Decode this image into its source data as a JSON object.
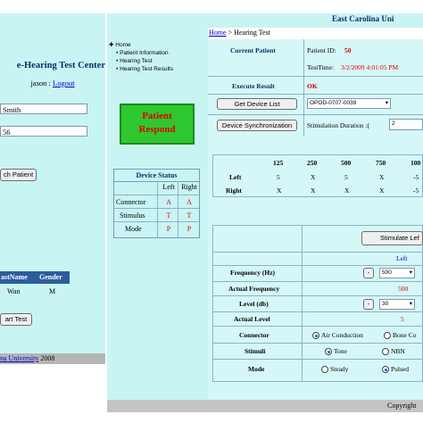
{
  "left": {
    "title": "e-Hearing Test Center",
    "user": "jason : ",
    "logout": "Logout",
    "first_name_value": "Smith",
    "id_value": "56",
    "search_button": "ch Patient",
    "table_headers": [
      "astName",
      "Gender"
    ],
    "table_row": [
      "Wan",
      "M"
    ],
    "start_button": "art Test",
    "footer_link": "na University",
    "footer_year": "2008"
  },
  "header": {
    "title": "East Carolina Uni"
  },
  "breadcrumb": {
    "home": "Home",
    "separator": " > ",
    "current": "Hearing Test"
  },
  "nav": {
    "items": [
      "Home",
      "Patient Information",
      "Hearing Test",
      "Hearing Test Results"
    ]
  },
  "status_box": {
    "line1": "Patient",
    "line2": "Respond"
  },
  "device_status": {
    "title": "Device Status",
    "cols": [
      "Left",
      "Right"
    ],
    "rows": [
      {
        "label": "Connector",
        "left": "A",
        "right": "A"
      },
      {
        "label": "Stimulus",
        "left": "T",
        "right": "T"
      },
      {
        "label": "Mode",
        "left": "P",
        "right": "P"
      }
    ]
  },
  "info": {
    "current_patient_label": "Current Patient",
    "patient_id_label": "Patient ID:",
    "patient_id_value": "50",
    "test_time_label": "TestTime:",
    "test_time_value": "3/2/2009 4:01:05 PM",
    "execute_result_label": "Execute Result",
    "execute_result_value": "OK",
    "get_device_button": "Get Device List",
    "device_value": "OPOD-0707-0039",
    "device_sync_button": "Device Synchronization",
    "stim_duration_label": "Stimulation Duration :(",
    "stim_duration_value": "2"
  },
  "freq_table": {
    "frequencies": [
      "125",
      "250",
      "500",
      "750",
      "100"
    ],
    "left_label": "Left",
    "right_label": "Right",
    "left_values": [
      "5",
      "X",
      "5",
      "X",
      "-5"
    ],
    "right_values": [
      "X",
      "X",
      "X",
      "X",
      "-5"
    ]
  },
  "control": {
    "stimulate_button": "Stimulate Lef",
    "side_label": "Left",
    "frequency_label": "Frequency (Hz)",
    "frequency_minus": "-",
    "frequency_value": "500",
    "actual_frequency_label": "Actual Frequency",
    "actual_frequency_value": "500",
    "level_label": "Level (db)",
    "level_minus": "-",
    "level_value": "30",
    "actual_level_label": "Actual Level",
    "actual_level_value": "5",
    "connector_label": "Connector",
    "connector_opt1": "Air Conduction",
    "connector_opt2": "Bone Co",
    "stimuli_label": "Stimuli",
    "stimuli_opt1": "Tone",
    "stimuli_opt2": "NBN",
    "mode_label": "Mode",
    "mode_opt1": "Steady",
    "mode_opt2": "Pulsed"
  },
  "footer": {
    "copyright": "Copyright"
  },
  "colors": {
    "panel_bg": "#c9f4f4",
    "status_box_bg": "#2fc72f",
    "status_text": "#e00000",
    "accent_blue": "#0000cc",
    "table_header": "#2c5c9e"
  }
}
